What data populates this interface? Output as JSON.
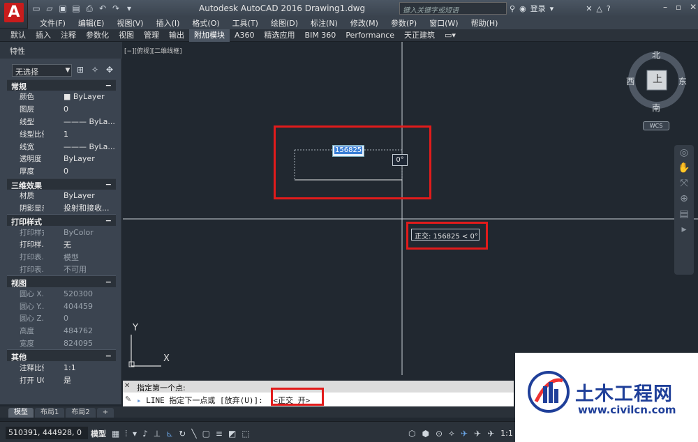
{
  "app": {
    "title": "Autodesk AutoCAD 2016    Drawing1.dwg",
    "logo": "A",
    "search_placeholder": "键入关键字或短语",
    "user": "登录"
  },
  "menu": [
    "文件(F)",
    "编辑(E)",
    "视图(V)",
    "插入(I)",
    "格式(O)",
    "工具(T)",
    "绘图(D)",
    "标注(N)",
    "修改(M)",
    "参数(P)",
    "窗口(W)",
    "帮助(H)"
  ],
  "ribbon_tabs": [
    {
      "label": "默认"
    },
    {
      "label": "插入"
    },
    {
      "label": "注释"
    },
    {
      "label": "参数化"
    },
    {
      "label": "视图"
    },
    {
      "label": "管理"
    },
    {
      "label": "输出"
    },
    {
      "label": "附加模块",
      "active": true
    },
    {
      "label": "A360"
    },
    {
      "label": "精选应用"
    },
    {
      "label": "BIM 360"
    },
    {
      "label": "Performance"
    },
    {
      "label": "天正建筑"
    }
  ],
  "properties": {
    "title": "特性",
    "selection": "无选择",
    "sections": [
      {
        "name": "常规",
        "toggle": "−",
        "rows": [
          [
            "颜色",
            "■ ByLayer"
          ],
          [
            "图层",
            "0"
          ],
          [
            "线型",
            "——— ByLa..."
          ],
          [
            "线型比例",
            "1"
          ],
          [
            "线宽",
            "——— ByLa..."
          ],
          [
            "透明度",
            "ByLayer"
          ],
          [
            "厚度",
            "0"
          ]
        ]
      },
      {
        "name": "三维效果",
        "toggle": "−",
        "rows": [
          [
            "材质",
            "ByLayer"
          ],
          [
            "阴影显示",
            "投射和接收..."
          ]
        ]
      },
      {
        "name": "打印样式",
        "toggle": "−",
        "rows": [
          [
            "打印样式",
            "ByColor",
            "dim"
          ],
          [
            "打印样...",
            "无"
          ],
          [
            "打印表...",
            "模型",
            "dim"
          ],
          [
            "打印表...",
            "不可用",
            "dim"
          ]
        ]
      },
      {
        "name": "视图",
        "toggle": "−",
        "rows": [
          [
            "圆心 X...",
            "520300",
            "dim"
          ],
          [
            "圆心 Y...",
            "404459",
            "dim"
          ],
          [
            "圆心 Z...",
            "0",
            "dim"
          ],
          [
            "高度",
            "484762",
            "dim"
          ],
          [
            "宽度",
            "824095",
            "dim"
          ]
        ]
      },
      {
        "name": "其他",
        "toggle": "−",
        "rows": [
          [
            "注释比例",
            "1:1"
          ],
          [
            "打开 UC...",
            "是"
          ]
        ]
      }
    ]
  },
  "viewport": {
    "label": "[−][俯视][二维线框]",
    "compass": {
      "north": "北",
      "south": "南",
      "east": "东",
      "west": "西",
      "top": "上"
    },
    "wcs": "WCS",
    "axis_x": "X",
    "axis_y": "Y"
  },
  "dynamic": {
    "length": "156825",
    "angle": "0°",
    "ortho_tip": "正交: 156825 < 0°"
  },
  "command": {
    "history": "指定第一个点:",
    "prompt": "LINE 指定下一点或 [放弃(U)]:",
    "ortho": "<正交 开>"
  },
  "layout_tabs": [
    {
      "label": "模型",
      "active": true
    },
    {
      "label": "布局1"
    },
    {
      "label": "布局2"
    },
    {
      "label": "+"
    }
  ],
  "status": {
    "coords": "510391, 444928, 0",
    "model": "模型",
    "scale": "1:1 / 100%"
  },
  "watermark": {
    "title": "土木工程网",
    "url": "www.civilcn.com"
  }
}
